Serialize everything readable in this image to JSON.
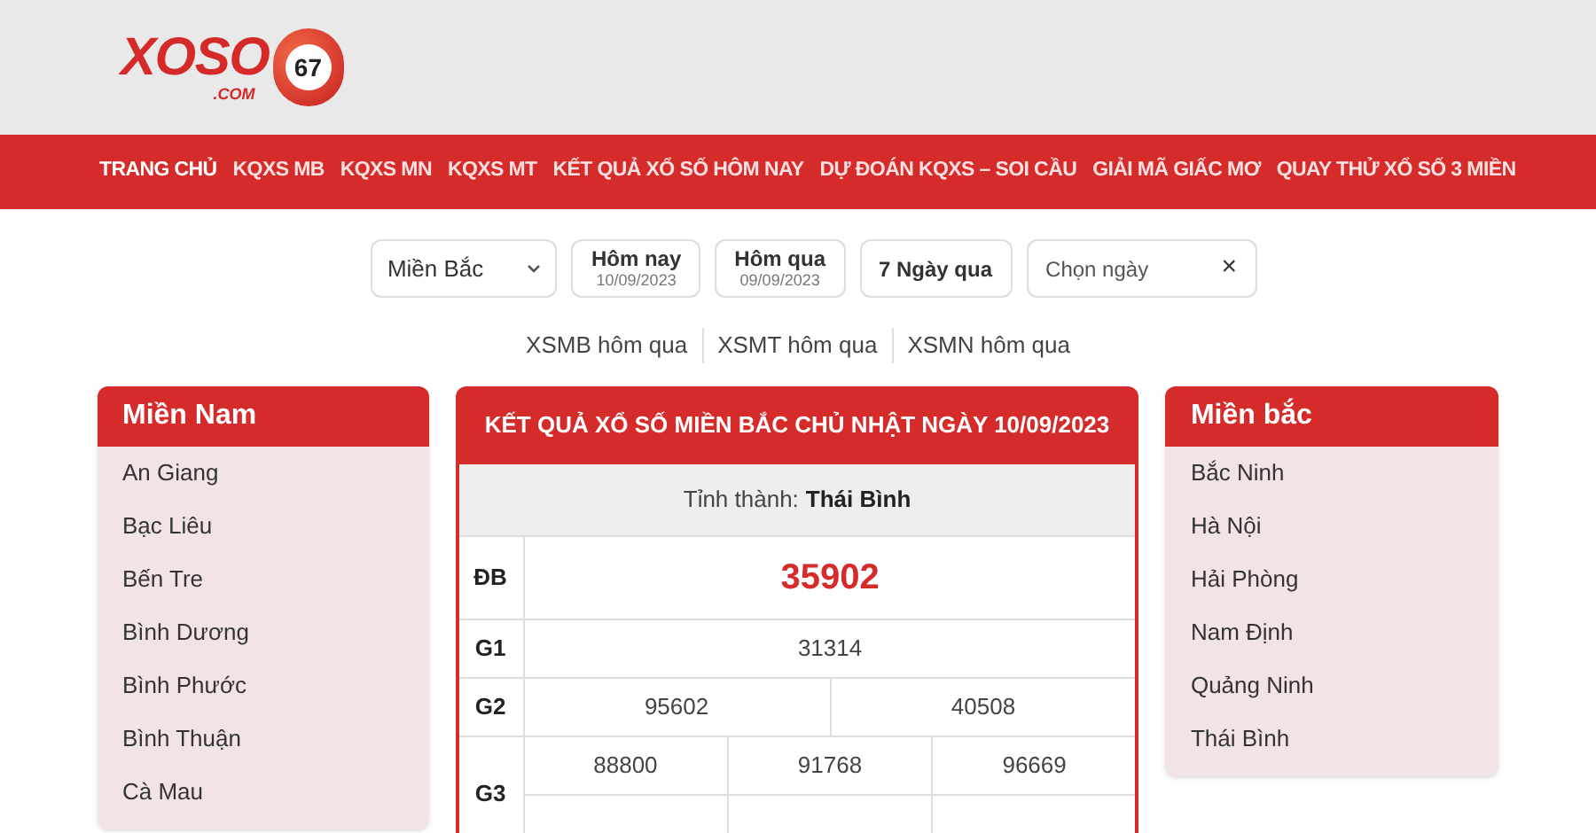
{
  "logo": {
    "text": "XOSO",
    "domain": ".COM",
    "ball": "67"
  },
  "nav": [
    {
      "label": "TRANG CHỦ",
      "selected": true
    },
    {
      "label": "KQXS MB",
      "selected": false
    },
    {
      "label": "KQXS MN",
      "selected": false
    },
    {
      "label": "KQXS MT",
      "selected": false
    },
    {
      "label": "KẾT QUẢ XỔ SỐ HÔM NAY",
      "selected": false
    },
    {
      "label": "DỰ ĐOÁN KQXS – SOI CẦU",
      "selected": false
    },
    {
      "label": "GIẢI MÃ GIẤC MƠ",
      "selected": false
    },
    {
      "label": "QUAY THỬ XỔ SỐ 3 MIỀN",
      "selected": false
    }
  ],
  "filters": {
    "region": "Miền Bắc",
    "buttons": [
      {
        "label": "Hôm nay",
        "date": "10/09/2023"
      },
      {
        "label": "Hôm qua",
        "date": "09/09/2023"
      },
      {
        "label": "7 Ngày qua"
      }
    ],
    "date_picker": {
      "placeholder": "Chọn ngày",
      "clear": "×"
    }
  },
  "quick_links": [
    "XSMB hôm qua",
    "XSMT hôm qua",
    "XSMN hôm qua"
  ],
  "left_panel": {
    "title": "Miền Nam",
    "items": [
      "An Giang",
      "Bạc Liêu",
      "Bến Tre",
      "Bình Dương",
      "Bình Phước",
      "Bình Thuận",
      "Cà Mau"
    ]
  },
  "results": {
    "title": "KẾT QUẢ XỔ SỐ MIỀN BẮC CHỦ NHẬT NGÀY 10/09/2023",
    "province_label": "Tỉnh thành:",
    "province": "Thái Bình",
    "prizes": [
      {
        "name": "ĐB",
        "kind": "special",
        "rows": [
          [
            "35902"
          ]
        ]
      },
      {
        "name": "G1",
        "kind": "normal",
        "rows": [
          [
            "31314"
          ]
        ]
      },
      {
        "name": "G2",
        "kind": "normal",
        "rows": [
          [
            "95602",
            "40508"
          ]
        ]
      },
      {
        "name": "G3",
        "kind": "normal",
        "rows": [
          [
            "88800",
            "91768",
            "96669"
          ]
        ]
      }
    ]
  },
  "right_panel": {
    "title": "Miền bắc",
    "items": [
      "Bắc Ninh",
      "Hà Nội",
      "Hải Phòng",
      "Nam Định",
      "Quảng Ninh",
      "Thái Bình"
    ]
  }
}
